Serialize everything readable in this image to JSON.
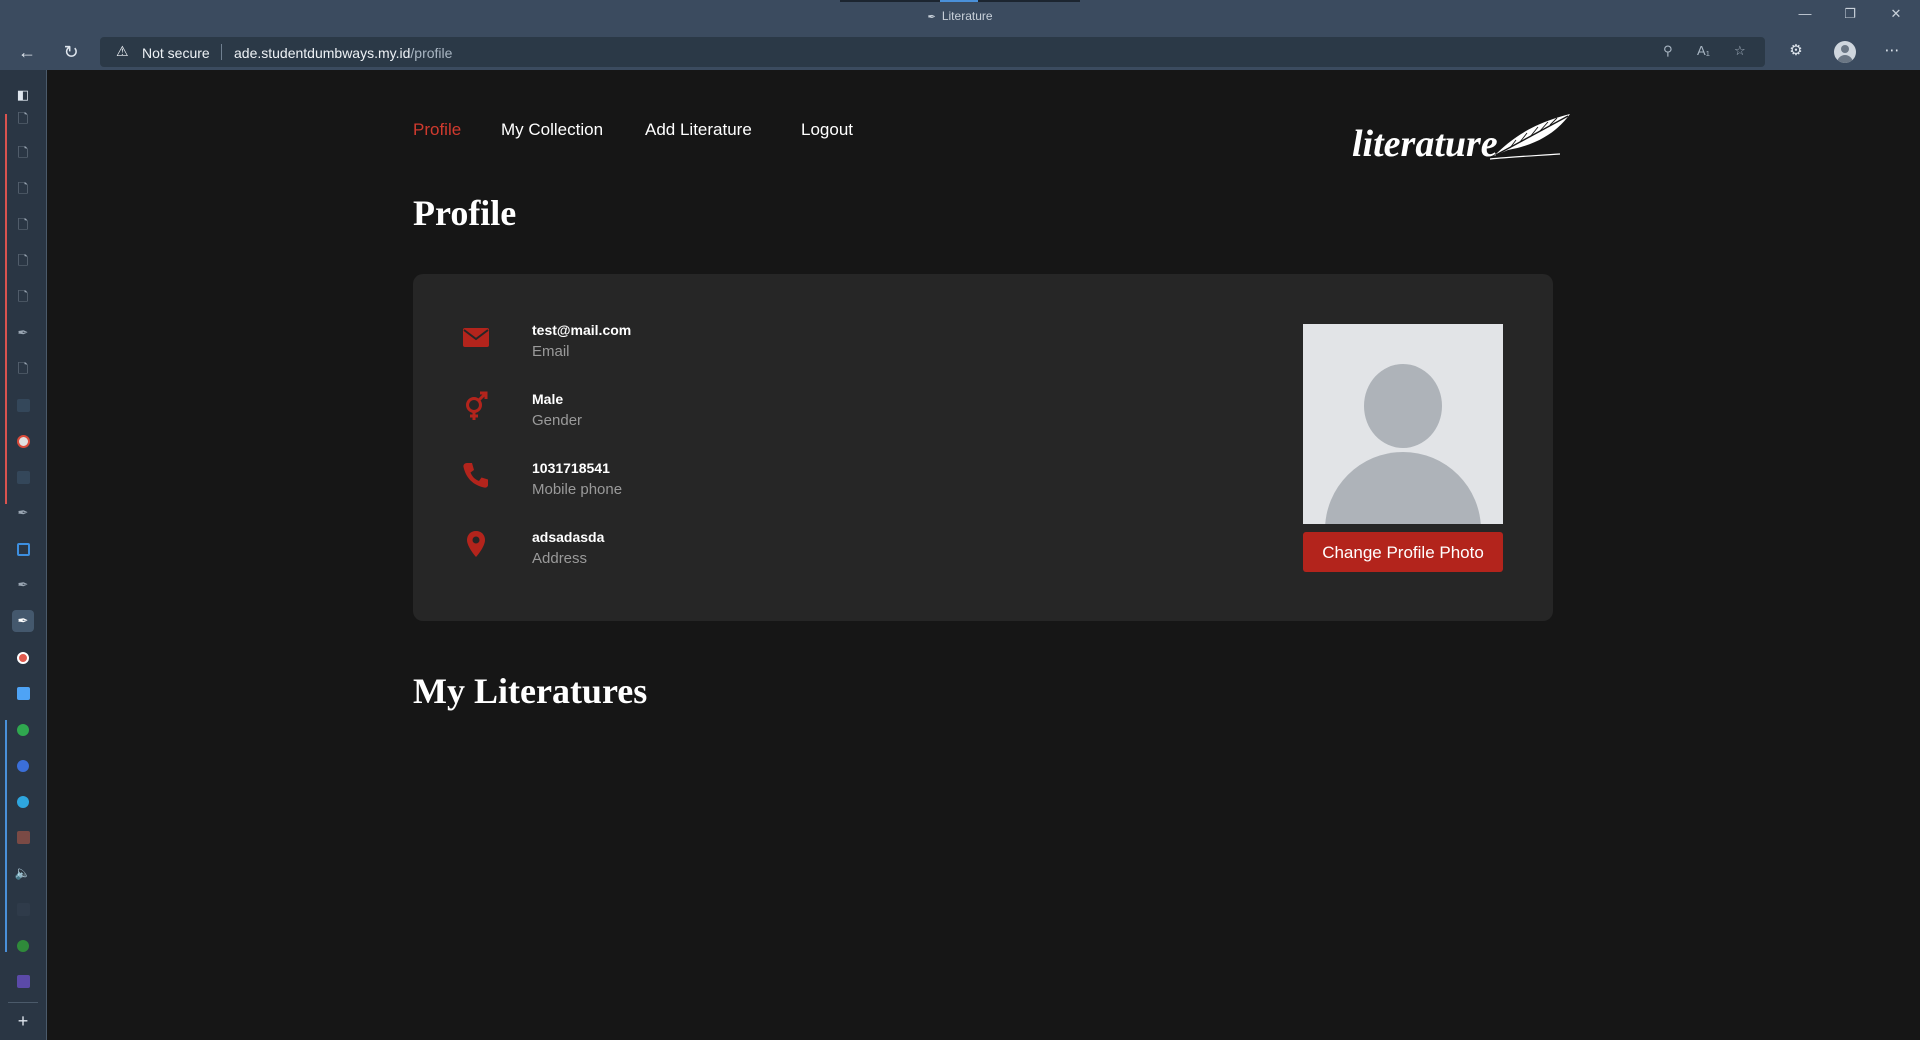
{
  "browser": {
    "tab_title": "Literature",
    "security_label": "Not secure",
    "url_host": "ade.studentdumbways.my.id",
    "url_path": "/profile"
  },
  "nav": {
    "items": [
      {
        "label": "Profile",
        "active": true
      },
      {
        "label": "My Collection",
        "active": false
      },
      {
        "label": "Add Literature",
        "active": false
      },
      {
        "label": "Logout",
        "active": false
      }
    ]
  },
  "logo": {
    "text": "literature"
  },
  "profile": {
    "heading": "Profile",
    "fields": [
      {
        "value": "test@mail.com",
        "label": "Email",
        "icon": "mail-icon"
      },
      {
        "value": "Male",
        "label": "Gender",
        "icon": "gender-icon"
      },
      {
        "value": "1031718541",
        "label": "Mobile phone",
        "icon": "phone-icon"
      },
      {
        "value": "adsadasda",
        "label": "Address",
        "icon": "location-pin-icon"
      }
    ],
    "change_photo_label": "Change Profile Photo"
  },
  "literatures": {
    "heading": "My Literatures"
  },
  "colors": {
    "accent": "#b3241c",
    "active_nav": "#d03a2e",
    "background": "#161616",
    "card": "#262626"
  }
}
